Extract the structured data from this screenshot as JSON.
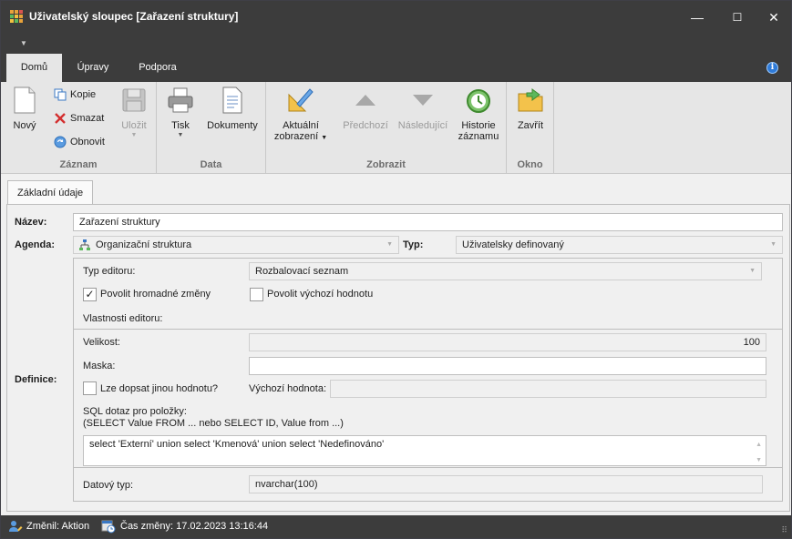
{
  "window": {
    "title": "Uživatelský sloupec [Zařazení struktury]",
    "minimize": "—",
    "maximize": "☐",
    "close": "✕"
  },
  "qat": {
    "arrow": "▼"
  },
  "tabs": [
    {
      "label": "Domů",
      "active": true
    },
    {
      "label": "Úpravy",
      "active": false
    },
    {
      "label": "Podpora",
      "active": false
    }
  ],
  "info_icon": "i",
  "ribbon": {
    "groups": {
      "zaznam": "Záznam",
      "data": "Data",
      "zobrazit": "Zobrazit",
      "okno": "Okno"
    },
    "buttons": {
      "novy": "Nový",
      "kopie": "Kopie",
      "smazat": "Smazat",
      "obnovit": "Obnovit",
      "ulozit": "Uložit",
      "tisk": "Tisk",
      "dokumenty": "Dokumenty",
      "aktualni_1": "Aktuální",
      "aktualni_2": "zobrazení",
      "predchozi": "Předchozí",
      "nasledujici": "Následující",
      "historie_1": "Historie",
      "historie_2": "záznamu",
      "zavrit": "Zavřít"
    }
  },
  "page_tab": "Základní údaje",
  "form": {
    "nazev_label": "Název:",
    "nazev_value": "Zařazení struktury",
    "agenda_label": "Agenda:",
    "agenda_value": "Organizační struktura",
    "typ_label": "Typ:",
    "typ_value": "Uživatelsky definovaný",
    "definice_label": "Definice:",
    "typ_editoru_label": "Typ editoru:",
    "typ_editoru_value": "Rozbalovací seznam",
    "povolit_hromadne": "Povolit hromadné změny",
    "povolit_hromadne_checked": true,
    "povolit_vychozi": "Povolit výchozí hodnotu",
    "povolit_vychozi_checked": false,
    "vlastnosti_label": "Vlastnosti editoru:",
    "velikost_label": "Velikost:",
    "velikost_value": "100",
    "maska_label": "Maska:",
    "maska_value": "",
    "lze_dopsat": "Lze dopsat jinou hodnotu?",
    "lze_dopsat_checked": false,
    "vychozi_hodnota_label": "Výchozí hodnota:",
    "vychozi_hodnota_value": "",
    "sql_label_1": "SQL dotaz pro položky:",
    "sql_label_2": "(SELECT Value FROM ... nebo SELECT ID, Value from ...)",
    "sql_value": "select 'Externí' union select 'Kmenová'  union select 'Nedefinováno'",
    "datovy_typ_label": "Datový typ:",
    "datovy_typ_value": "nvarchar(100)",
    "check_mark": "✓"
  },
  "statusbar": {
    "zmenil": "Změnil: Aktion",
    "cas_zmeny": "Čas změny: 17.02.2023 13:16:44",
    "grip": "⠿"
  },
  "colors": {
    "titlebar": "#3c3c3c",
    "ribbon": "#e6e6e6",
    "accent": "#2f7bd8"
  }
}
